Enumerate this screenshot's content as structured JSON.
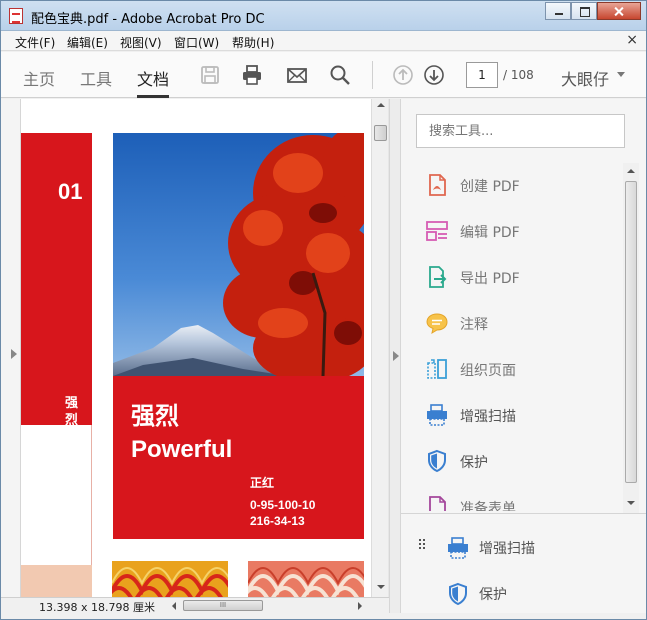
{
  "window": {
    "title": "配色宝典.pdf - Adobe Acrobat Pro DC"
  },
  "menu": {
    "items": [
      {
        "label": "文件(F)"
      },
      {
        "label": "编辑(E)"
      },
      {
        "label": "视图(V)"
      },
      {
        "label": "窗口(W)"
      },
      {
        "label": "帮助(H)"
      }
    ],
    "close": "×"
  },
  "toolbar": {
    "tabs": [
      {
        "label": "主页"
      },
      {
        "label": "工具"
      },
      {
        "label": "文档"
      }
    ],
    "active_tab": "文档",
    "icons": [
      "save-icon",
      "print-icon",
      "email-icon",
      "search-icon",
      "page-up-icon",
      "page-down-icon"
    ],
    "page_current": "1",
    "page_total": "/ 108",
    "user": "大眼仔"
  },
  "document": {
    "band_number": "01",
    "band_text": "强烈",
    "card_title_cn": "强烈",
    "card_title_en": "Powerful",
    "card_subtitle": "正红",
    "card_code1": "0-95-100-10",
    "card_code2": "216-34-13",
    "accent_red": "#d7161c"
  },
  "status": {
    "size": "13.398 x 18.798 厘米",
    "hscroll_grip": "III"
  },
  "panel": {
    "search_placeholder": "搜索工具...",
    "tools": [
      {
        "label": "创建 PDF",
        "icon": "create-pdf-icon"
      },
      {
        "label": "编辑 PDF",
        "icon": "edit-pdf-icon"
      },
      {
        "label": "导出 PDF",
        "icon": "export-pdf-icon"
      },
      {
        "label": "注释",
        "icon": "comment-icon"
      },
      {
        "label": "组织页面",
        "icon": "organize-pages-icon"
      },
      {
        "label": "增强扫描",
        "icon": "enhance-scan-icon"
      },
      {
        "label": "保护",
        "icon": "protect-icon"
      },
      {
        "label": "准备表单",
        "icon": "prepare-form-icon"
      }
    ],
    "dragging_tools": [
      {
        "label": "增强扫描",
        "icon": "enhance-scan-icon"
      },
      {
        "label": "保护",
        "icon": "protect-icon"
      }
    ]
  }
}
